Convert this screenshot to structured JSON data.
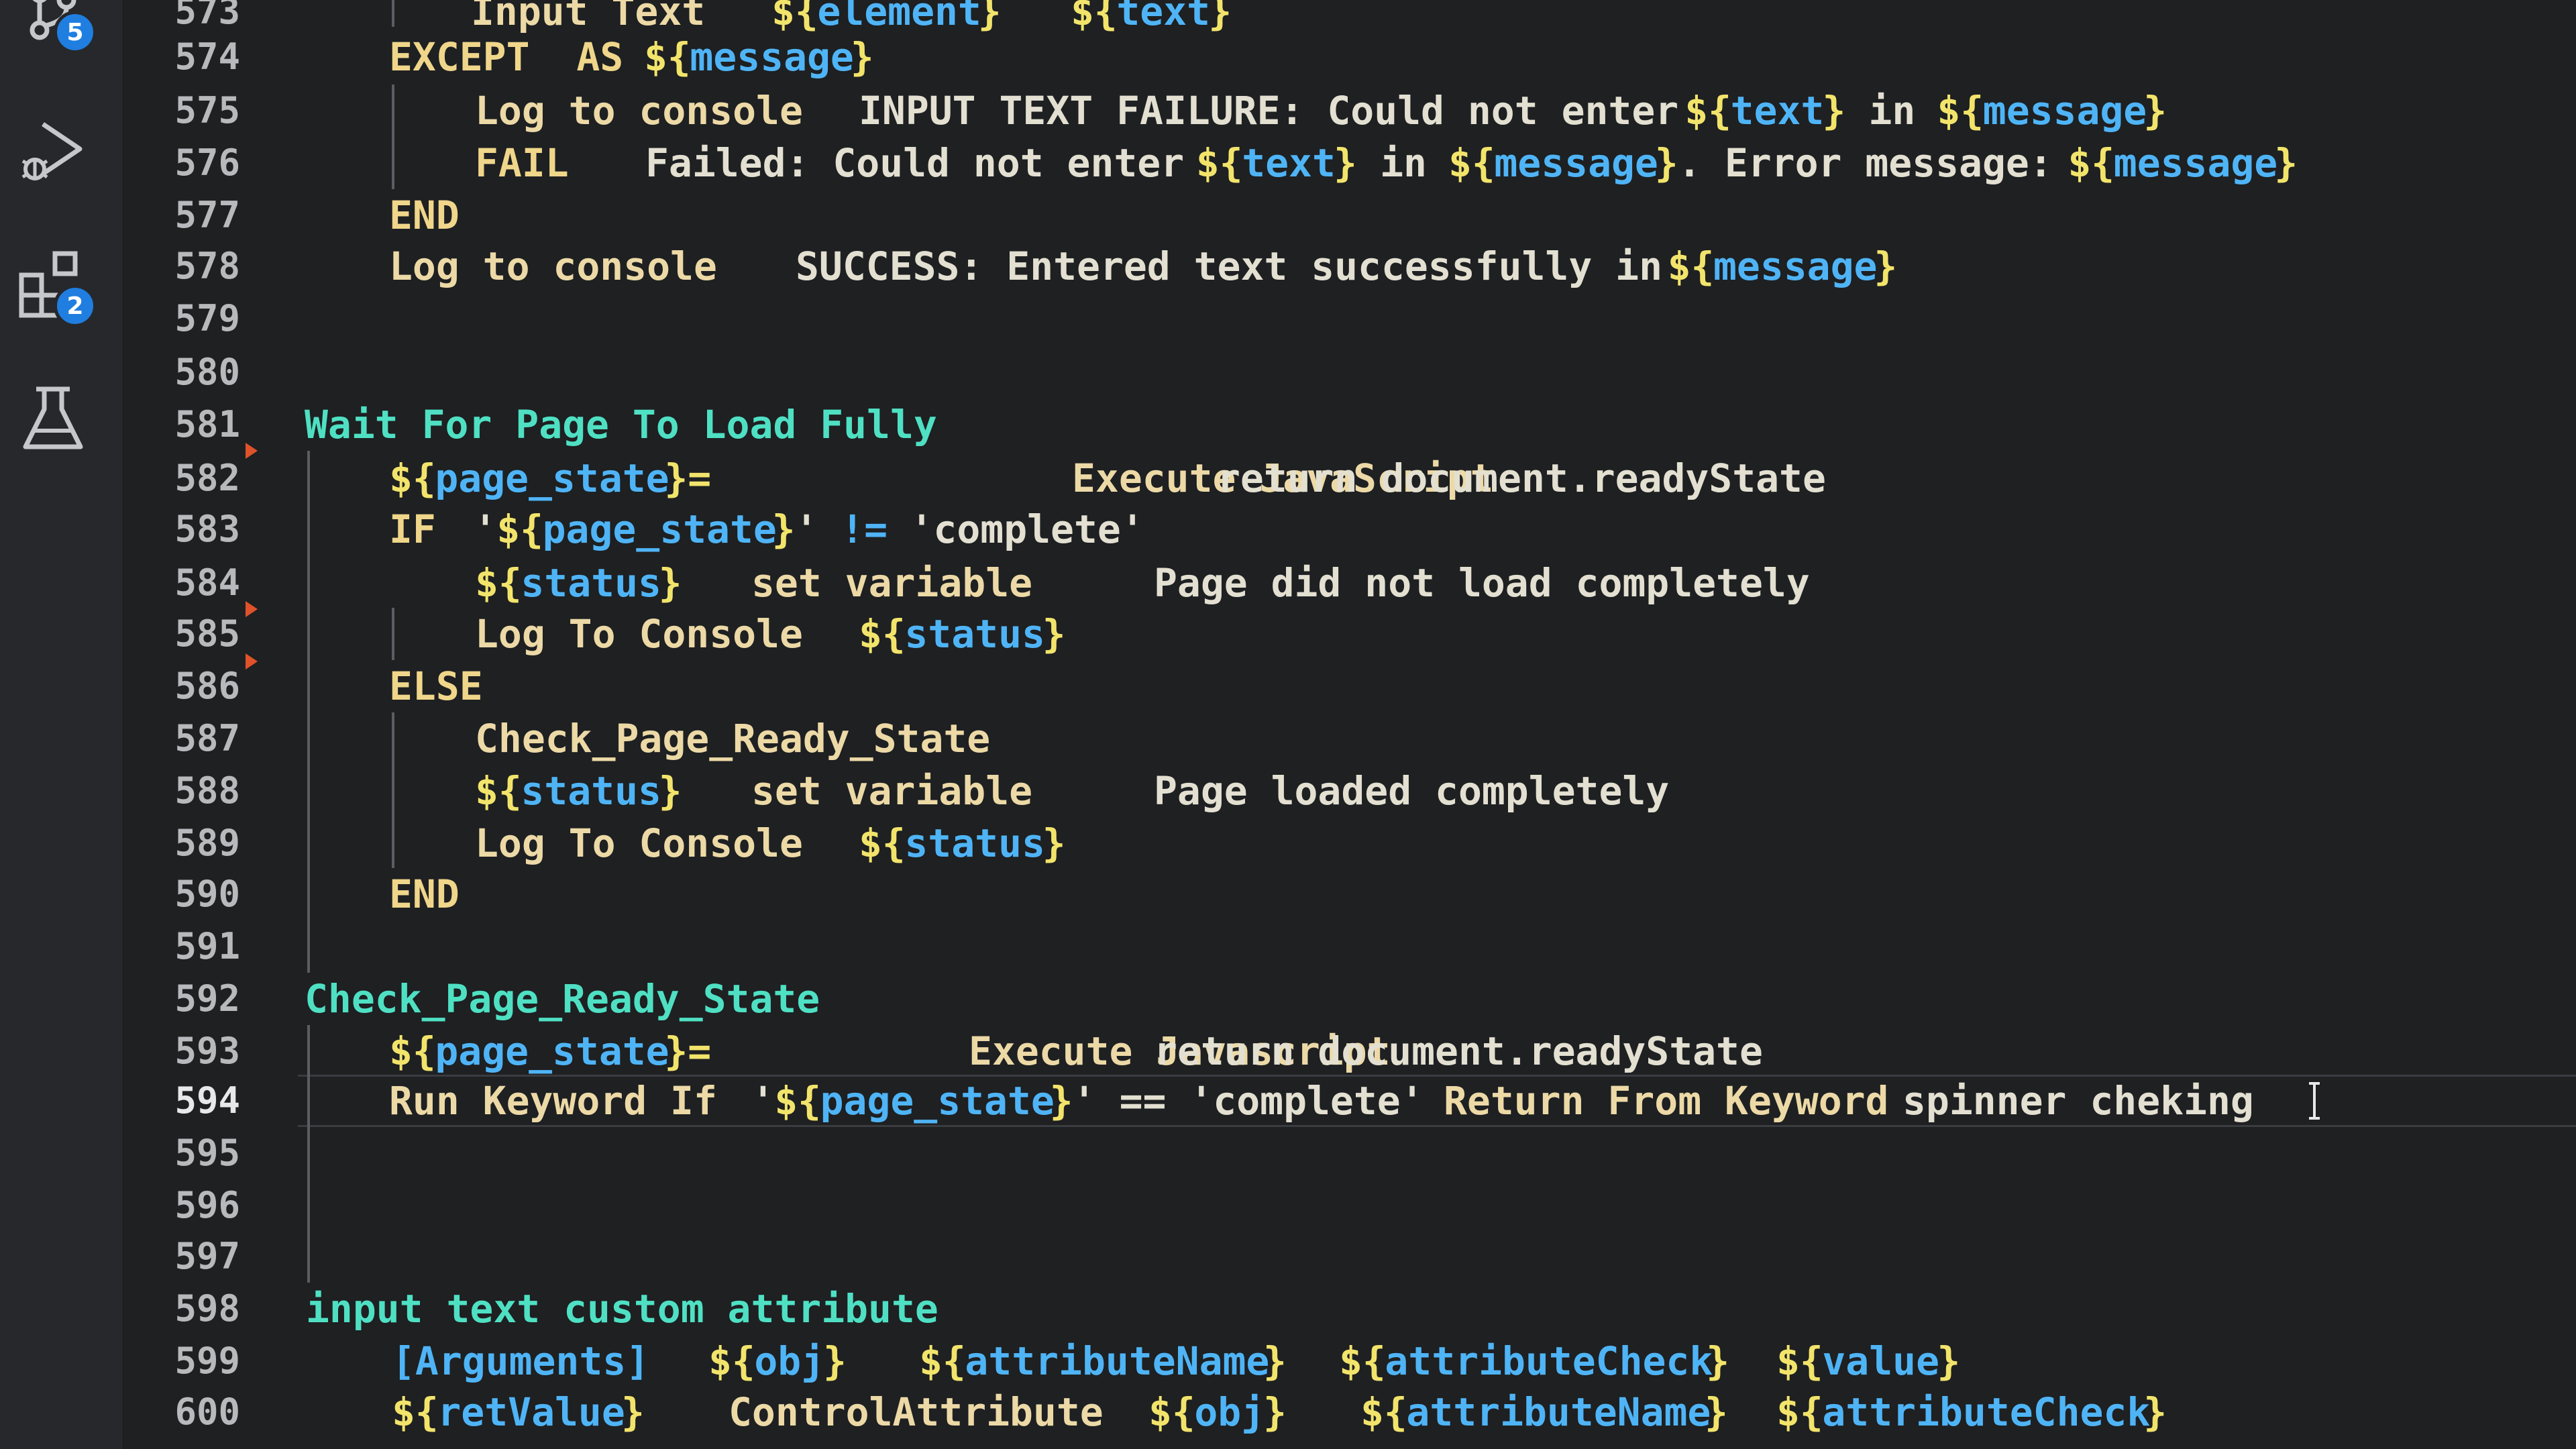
{
  "activity_bar": {
    "items": [
      {
        "name": "source-control",
        "icon": "source-control-icon",
        "badge": "5"
      },
      {
        "name": "run-and-debug",
        "icon": "run-debug-icon"
      },
      {
        "name": "extensions",
        "icon": "extensions-icon",
        "badge": "2"
      },
      {
        "name": "testing",
        "icon": "flask-icon"
      }
    ]
  },
  "editor": {
    "current_line": 594,
    "lines": [
      {
        "n": "573",
        "segs": [
          {
            "t": "Input Text",
            "c": "kw"
          },
          {
            "t": "${",
            "c": "var"
          },
          {
            "t": "element",
            "c": "vn"
          },
          {
            "t": "}",
            "c": "var"
          },
          {
            "t": "${",
            "c": "var"
          },
          {
            "t": "text",
            "c": "vn"
          },
          {
            "t": "}",
            "c": "var"
          }
        ]
      },
      {
        "n": "574",
        "segs": [
          {
            "t": "EXCEPT  AS",
            "c": "ctrl"
          },
          {
            "t": "${",
            "c": "var"
          },
          {
            "t": "message",
            "c": "vn"
          },
          {
            "t": "}",
            "c": "var"
          }
        ]
      },
      {
        "n": "575",
        "segs": [
          {
            "t": "Log to console",
            "c": "kw"
          },
          {
            "t": "INPUT TEXT FAILURE: Could not enter ",
            "c": "txt"
          },
          {
            "t": "${",
            "c": "var"
          },
          {
            "t": "text",
            "c": "vn"
          },
          {
            "t": "}",
            "c": "var"
          },
          {
            "t": " in ",
            "c": "txt"
          },
          {
            "t": "${",
            "c": "var"
          },
          {
            "t": "message",
            "c": "vn"
          },
          {
            "t": "}",
            "c": "var"
          }
        ]
      },
      {
        "n": "576",
        "segs": [
          {
            "t": "FAIL",
            "c": "ctrl"
          },
          {
            "t": "Failed: Could not enter ",
            "c": "txt"
          },
          {
            "t": "${",
            "c": "var"
          },
          {
            "t": "text",
            "c": "vn"
          },
          {
            "t": "}",
            "c": "var"
          },
          {
            "t": " in ",
            "c": "txt"
          },
          {
            "t": "${",
            "c": "var"
          },
          {
            "t": "message",
            "c": "vn"
          },
          {
            "t": "}",
            "c": "var"
          },
          {
            "t": ". Error message: ",
            "c": "txt"
          },
          {
            "t": "${",
            "c": "var"
          },
          {
            "t": "message",
            "c": "vn"
          },
          {
            "t": "}",
            "c": "var"
          }
        ]
      },
      {
        "n": "577",
        "segs": [
          {
            "t": "END",
            "c": "ctrl"
          }
        ]
      },
      {
        "n": "578",
        "segs": [
          {
            "t": "Log to console",
            "c": "kw"
          },
          {
            "t": "SUCCESS: Entered text successfully in ",
            "c": "txt"
          },
          {
            "t": "${",
            "c": "var"
          },
          {
            "t": "message",
            "c": "vn"
          },
          {
            "t": "}",
            "c": "var"
          }
        ]
      },
      {
        "n": "579",
        "segs": []
      },
      {
        "n": "580",
        "segs": []
      },
      {
        "n": "581",
        "segs": [
          {
            "t": "Wait For Page To Load Fully",
            "c": "kname"
          }
        ]
      },
      {
        "n": "582",
        "segs": [
          {
            "t": "${",
            "c": "var"
          },
          {
            "t": "page_state",
            "c": "vn"
          },
          {
            "t": "}=",
            "c": "var"
          },
          {
            "t": "Execute JavaScript",
            "c": "kw"
          },
          {
            "t": "return document.readyState",
            "c": "txt"
          }
        ]
      },
      {
        "n": "583",
        "segs": [
          {
            "t": "IF",
            "c": "ctrl"
          },
          {
            "t": "'",
            "c": "txt"
          },
          {
            "t": "${",
            "c": "var"
          },
          {
            "t": "page_state",
            "c": "vn"
          },
          {
            "t": "}",
            "c": "var"
          },
          {
            "t": "' ",
            "c": "txt"
          },
          {
            "t": "!=",
            "c": "op"
          },
          {
            "t": " 'complete'",
            "c": "txt"
          }
        ]
      },
      {
        "n": "584",
        "segs": [
          {
            "t": "${",
            "c": "var"
          },
          {
            "t": "status",
            "c": "vn"
          },
          {
            "t": "}",
            "c": "var"
          },
          {
            "t": "set variable",
            "c": "kw"
          },
          {
            "t": "Page did not load completely",
            "c": "txt"
          }
        ]
      },
      {
        "n": "585",
        "segs": [
          {
            "t": "Log To Console",
            "c": "kw"
          },
          {
            "t": "${",
            "c": "var"
          },
          {
            "t": "status",
            "c": "vn"
          },
          {
            "t": "}",
            "c": "var"
          }
        ]
      },
      {
        "n": "586",
        "segs": [
          {
            "t": "ELSE",
            "c": "ctrl"
          }
        ]
      },
      {
        "n": "587",
        "segs": [
          {
            "t": "Check_Page_Ready_State",
            "c": "kw"
          }
        ]
      },
      {
        "n": "588",
        "segs": [
          {
            "t": "${",
            "c": "var"
          },
          {
            "t": "status",
            "c": "vn"
          },
          {
            "t": "}",
            "c": "var"
          },
          {
            "t": "set variable",
            "c": "kw"
          },
          {
            "t": "Page loaded completely",
            "c": "txt"
          }
        ]
      },
      {
        "n": "589",
        "segs": [
          {
            "t": "Log To Console",
            "c": "kw"
          },
          {
            "t": "${",
            "c": "var"
          },
          {
            "t": "status",
            "c": "vn"
          },
          {
            "t": "}",
            "c": "var"
          }
        ]
      },
      {
        "n": "590",
        "segs": [
          {
            "t": "END",
            "c": "ctrl"
          }
        ]
      },
      {
        "n": "591",
        "segs": []
      },
      {
        "n": "592",
        "segs": [
          {
            "t": "Check_Page_Ready_State",
            "c": "kname"
          }
        ]
      },
      {
        "n": "593",
        "segs": [
          {
            "t": "${",
            "c": "var"
          },
          {
            "t": "page_state",
            "c": "vn"
          },
          {
            "t": "}=",
            "c": "var"
          },
          {
            "t": "Execute Javascript",
            "c": "kw"
          },
          {
            "t": "return document.readyState",
            "c": "txt"
          }
        ]
      },
      {
        "n": "594",
        "segs": [
          {
            "t": "Run Keyword If",
            "c": "kw"
          },
          {
            "t": "'",
            "c": "txt"
          },
          {
            "t": "${",
            "c": "var"
          },
          {
            "t": "page_state",
            "c": "vn"
          },
          {
            "t": "}",
            "c": "var"
          },
          {
            "t": "' == 'complete'",
            "c": "txt"
          },
          {
            "t": "Return From Keyword",
            "c": "kw"
          },
          {
            "t": "spinner cheking",
            "c": "txt"
          }
        ]
      },
      {
        "n": "595",
        "segs": []
      },
      {
        "n": "596",
        "segs": []
      },
      {
        "n": "597",
        "segs": []
      },
      {
        "n": "598",
        "segs": [
          {
            "t": "input text custom attribute",
            "c": "kname"
          }
        ]
      },
      {
        "n": "599",
        "segs": [
          {
            "t": "[Arguments]",
            "c": "vn"
          },
          {
            "t": "${",
            "c": "var"
          },
          {
            "t": "obj",
            "c": "vn"
          },
          {
            "t": "}",
            "c": "var"
          },
          {
            "t": "${",
            "c": "var"
          },
          {
            "t": "attributeName",
            "c": "vn"
          },
          {
            "t": "}",
            "c": "var"
          },
          {
            "t": "${",
            "c": "var"
          },
          {
            "t": "attributeCheck",
            "c": "vn"
          },
          {
            "t": "}",
            "c": "var"
          },
          {
            "t": "${",
            "c": "var"
          },
          {
            "t": "value",
            "c": "vn"
          },
          {
            "t": "}",
            "c": "var"
          }
        ]
      },
      {
        "n": "600",
        "segs": [
          {
            "t": "${",
            "c": "var"
          },
          {
            "t": "retValue",
            "c": "vn"
          },
          {
            "t": "}",
            "c": "var"
          },
          {
            "t": "ControlAttribute",
            "c": "kw"
          },
          {
            "t": "${",
            "c": "var"
          },
          {
            "t": "obj",
            "c": "vn"
          },
          {
            "t": "}",
            "c": "var"
          },
          {
            "t": "${",
            "c": "var"
          },
          {
            "t": "attributeName",
            "c": "vn"
          },
          {
            "t": "}",
            "c": "var"
          },
          {
            "t": "${",
            "c": "var"
          },
          {
            "t": "attributeCheck",
            "c": "vn"
          },
          {
            "t": "}",
            "c": "var"
          }
        ]
      }
    ]
  }
}
